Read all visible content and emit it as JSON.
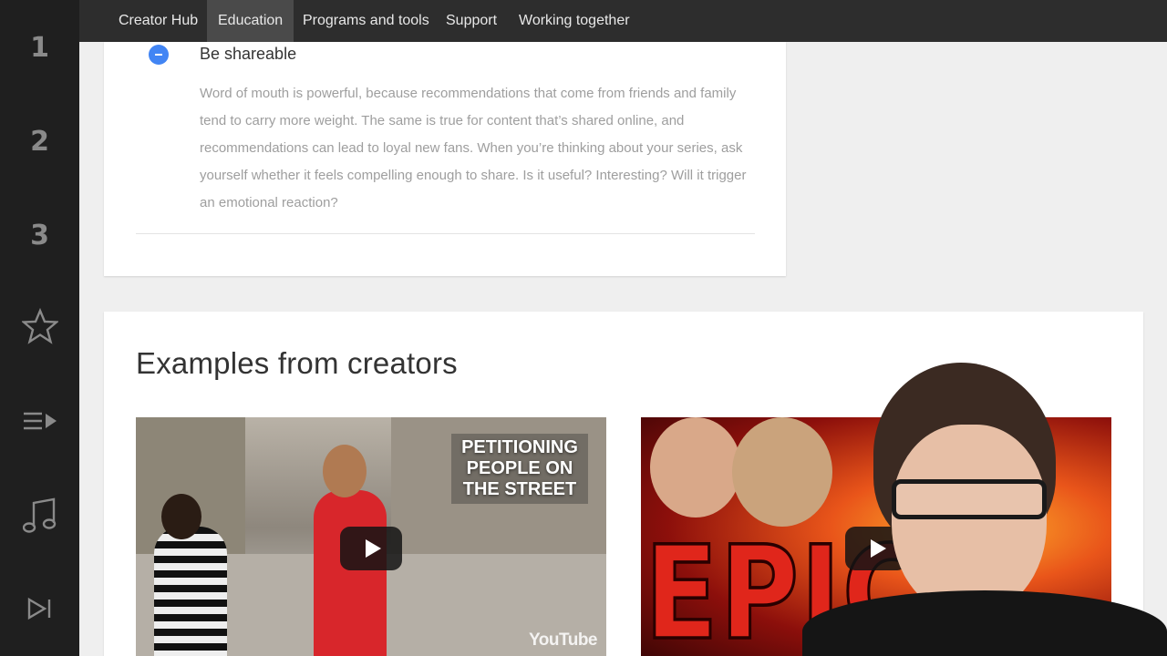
{
  "sidebar": {
    "items": [
      {
        "label": "1",
        "icon": "number-1"
      },
      {
        "label": "2",
        "icon": "number-2"
      },
      {
        "label": "3",
        "icon": "number-3"
      },
      {
        "label": "",
        "icon": "star-icon"
      },
      {
        "label": "",
        "icon": "playlist-icon"
      },
      {
        "label": "",
        "icon": "music-note-icon"
      },
      {
        "label": "",
        "icon": "skip-next-icon"
      }
    ]
  },
  "nav": {
    "items": [
      {
        "label": "Creator Hub",
        "active": false
      },
      {
        "label": "Education",
        "active": true
      },
      {
        "label": "Programs and tools",
        "active": false
      },
      {
        "label": "Support",
        "active": false
      },
      {
        "label": "Working together",
        "active": false
      }
    ]
  },
  "section": {
    "title": "Be shareable",
    "body": "Word of mouth is powerful, because recommendations that come from friends and family tend to carry more weight. The same is true for content that’s shared online, and recommendations can lead to loyal new fans. When you’re thinking about your series, ask yourself whether it feels compelling enough to share. Is it useful? Interesting? Will it trigger an emotional reaction?"
  },
  "examples": {
    "title": "Examples from creators",
    "videos": [
      {
        "overlay_text": "PETITIONING PEOPLE ON THE STREET",
        "watermark": "YouTube"
      },
      {
        "overlay_text": "EPIC"
      }
    ]
  },
  "colors": {
    "accent": "#4285f4",
    "nav_bg": "#2d2d2d",
    "sidebar_bg": "#1f1f1f"
  }
}
